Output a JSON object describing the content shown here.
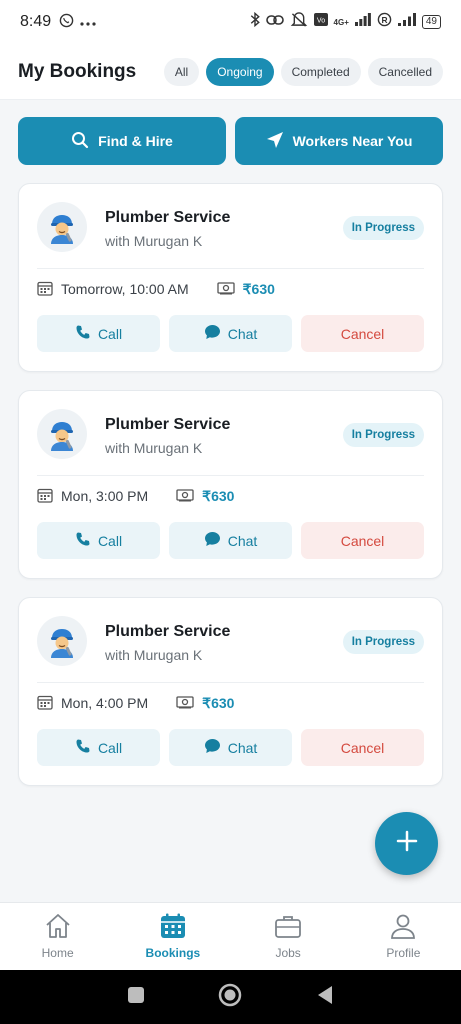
{
  "status_bar": {
    "time": "8:49",
    "battery": "49",
    "network": "4G+",
    "icons": [
      "whatsapp-icon",
      "more-dots-icon",
      "bluetooth-icon",
      "link-icon",
      "mute-icon",
      "volte-icon",
      "signal-icon",
      "registered-icon",
      "signal-icon",
      "battery-icon"
    ]
  },
  "header": {
    "title": "My Bookings",
    "filters": [
      {
        "label": "All",
        "active": false
      },
      {
        "label": "Ongoing",
        "active": true
      },
      {
        "label": "Completed",
        "active": false
      },
      {
        "label": "Cancelled",
        "active": false
      }
    ]
  },
  "quick_actions": {
    "find_hire_label": "Find & Hire",
    "find_hire_icon": "search-icon",
    "workers_near_label": "Workers Near You",
    "workers_near_icon": "navigation-arrow-icon"
  },
  "bookings": [
    {
      "service": "Plumber Service",
      "worker": "with Murugan K",
      "status": "In Progress",
      "datetime": "Tomorrow, 10:00 AM",
      "price": "₹630",
      "call_label": "Call",
      "chat_label": "Chat",
      "cancel_label": "Cancel",
      "avatar_icon": "plumber-avatar-icon"
    },
    {
      "service": "Plumber Service",
      "worker": "with Murugan K",
      "status": "In Progress",
      "datetime": "Mon, 3:00 PM",
      "price": "₹630",
      "call_label": "Call",
      "chat_label": "Chat",
      "cancel_label": "Cancel",
      "avatar_icon": "plumber-avatar-icon"
    },
    {
      "service": "Plumber Service",
      "worker": "with Murugan K",
      "status": "In Progress",
      "datetime": "Mon, 4:00 PM",
      "price": "₹630",
      "call_label": "Call",
      "chat_label": "Chat",
      "cancel_label": "Cancel",
      "avatar_icon": "plumber-avatar-icon"
    }
  ],
  "fab": {
    "icon": "plus-icon"
  },
  "bottom_nav": {
    "items": [
      {
        "label": "Home",
        "icon": "home-icon",
        "active": false
      },
      {
        "label": "Bookings",
        "icon": "calendar-icon",
        "active": true
      },
      {
        "label": "Jobs",
        "icon": "briefcase-icon",
        "active": false
      },
      {
        "label": "Profile",
        "icon": "profile-icon",
        "active": false
      }
    ]
  },
  "colors": {
    "accent": "#1b8db3",
    "badge_bg": "#e4f3f8",
    "cancel_text": "#d44a3f",
    "cancel_bg": "#fbeceb",
    "background": "#f4f6f8"
  }
}
